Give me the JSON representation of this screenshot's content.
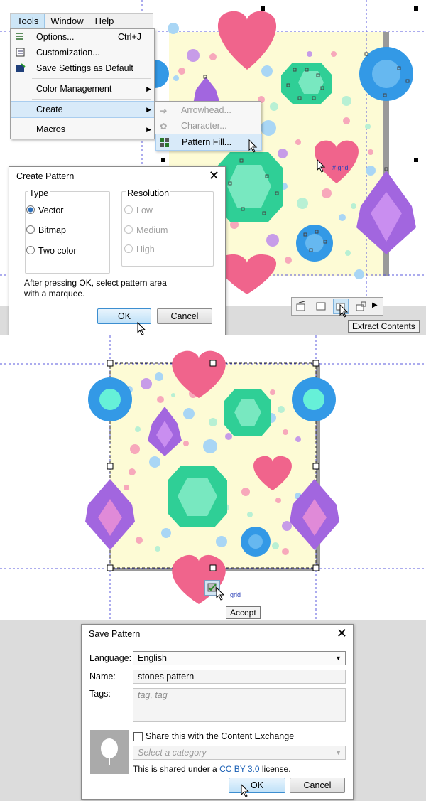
{
  "menubar": {
    "items": [
      "Tools",
      "Window",
      "Help"
    ]
  },
  "tools_menu": {
    "items": [
      {
        "label": "Options...",
        "shortcut": "Ctrl+J"
      },
      {
        "label": "Customization...",
        "shortcut": ""
      },
      {
        "label": "Save Settings as Default",
        "shortcut": ""
      },
      {
        "label": "Color Management",
        "shortcut": ""
      },
      {
        "label": "Create",
        "shortcut": ""
      },
      {
        "label": "Macros",
        "shortcut": ""
      }
    ]
  },
  "create_submenu": {
    "items": [
      "Arrowhead...",
      "Character...",
      "Pattern Fill..."
    ]
  },
  "create_pattern_dialog": {
    "title": "Create Pattern",
    "type_group": "Type",
    "type_options": [
      "Vector",
      "Bitmap",
      "Two color"
    ],
    "resolution_group": "Resolution",
    "resolution_options": [
      "Low",
      "Medium",
      "High"
    ],
    "note": "After pressing OK, select pattern area with a marquee.",
    "ok": "OK",
    "cancel": "Cancel"
  },
  "canvas": {
    "snap_label": "# grid",
    "grid_label": "grid",
    "extract_tooltip": "Extract Contents",
    "accept_tooltip": "Accept",
    "colors": {
      "pattern_bg": "#fdfbd5",
      "heart": "#f0648c",
      "emerald": "#2fcf96",
      "sapphire": "#3399e6",
      "amethyst": "#a266df",
      "guide": "#5a5adc"
    }
  },
  "save_pattern_dialog": {
    "title": "Save Pattern",
    "language_label": "Language:",
    "language_value": "English",
    "name_label": "Name:",
    "name_value": "stones pattern",
    "tags_label": "Tags:",
    "tags_placeholder": "tag, tag",
    "share_label": "Share this with the Content Exchange",
    "category_placeholder": "Select a category",
    "license_prefix": "This is shared under a ",
    "license_link": "CC BY 3.0",
    "license_suffix": " license.",
    "ok": "OK",
    "cancel": "Cancel"
  }
}
